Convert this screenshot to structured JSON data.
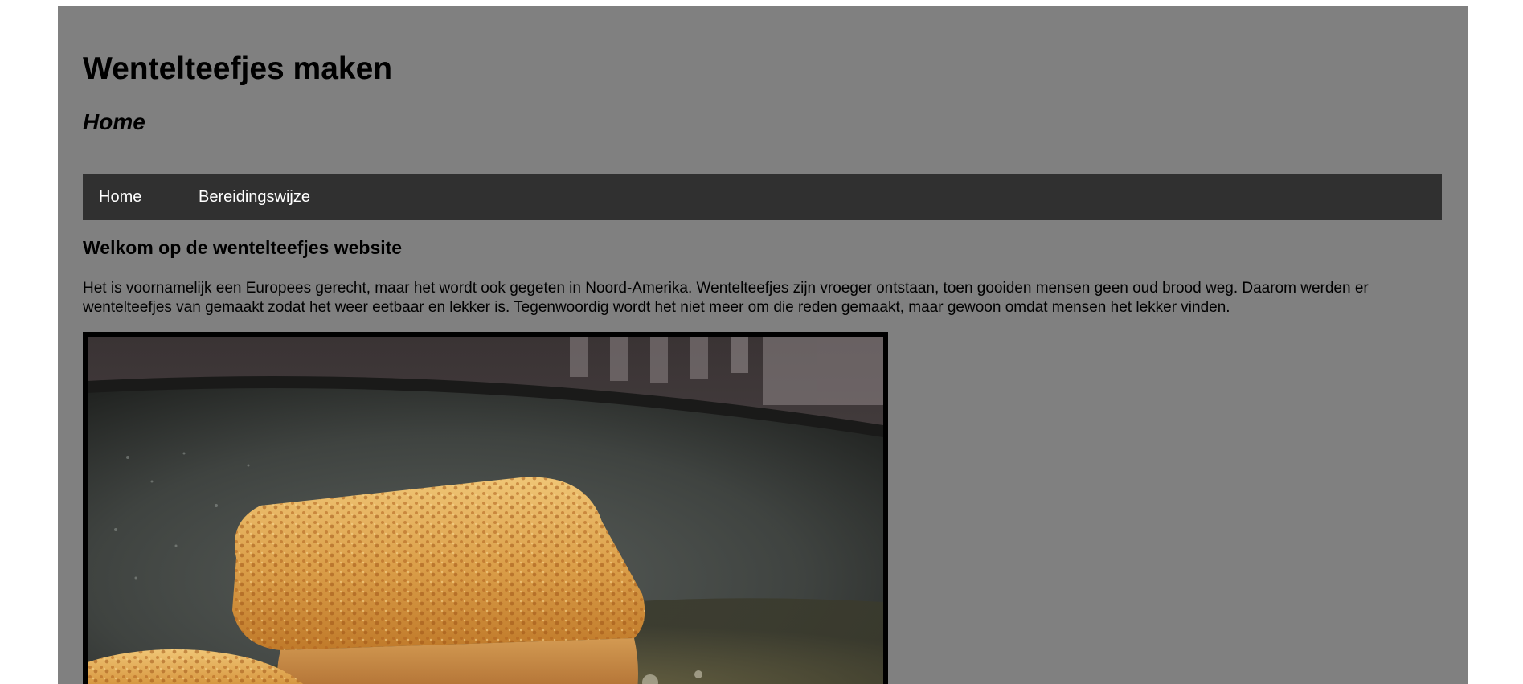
{
  "header": {
    "title": "Wentelteefjes maken",
    "subtitle": "Home"
  },
  "nav": {
    "items": [
      {
        "label": "Home"
      },
      {
        "label": "Bereidingswijze"
      }
    ]
  },
  "main": {
    "heading": "Welkom op de wentelteefjes website",
    "intro": "Het is voornamelijk een Europees gerecht, maar het wordt ook gegeten in Noord-Amerika. Wentelteefjes zijn vroeger ontstaan, toen gooiden mensen geen oud brood weg. Daarom werden er wentelteefjes van gemaakt zodat het weer eetbaar en lekker is. Tegenwoordig wordt het niet meer om die reden gemaakt, maar gewoon omdat mensen het lekker vinden.",
    "image": {
      "subject": "wentelteefjes-in-pan"
    }
  },
  "colors": {
    "page_background": "#808080",
    "outer_background": "#ffffff",
    "navbar": "#303030",
    "nav_text": "#ffffff",
    "text": "#000000",
    "photo_border": "#000000"
  }
}
